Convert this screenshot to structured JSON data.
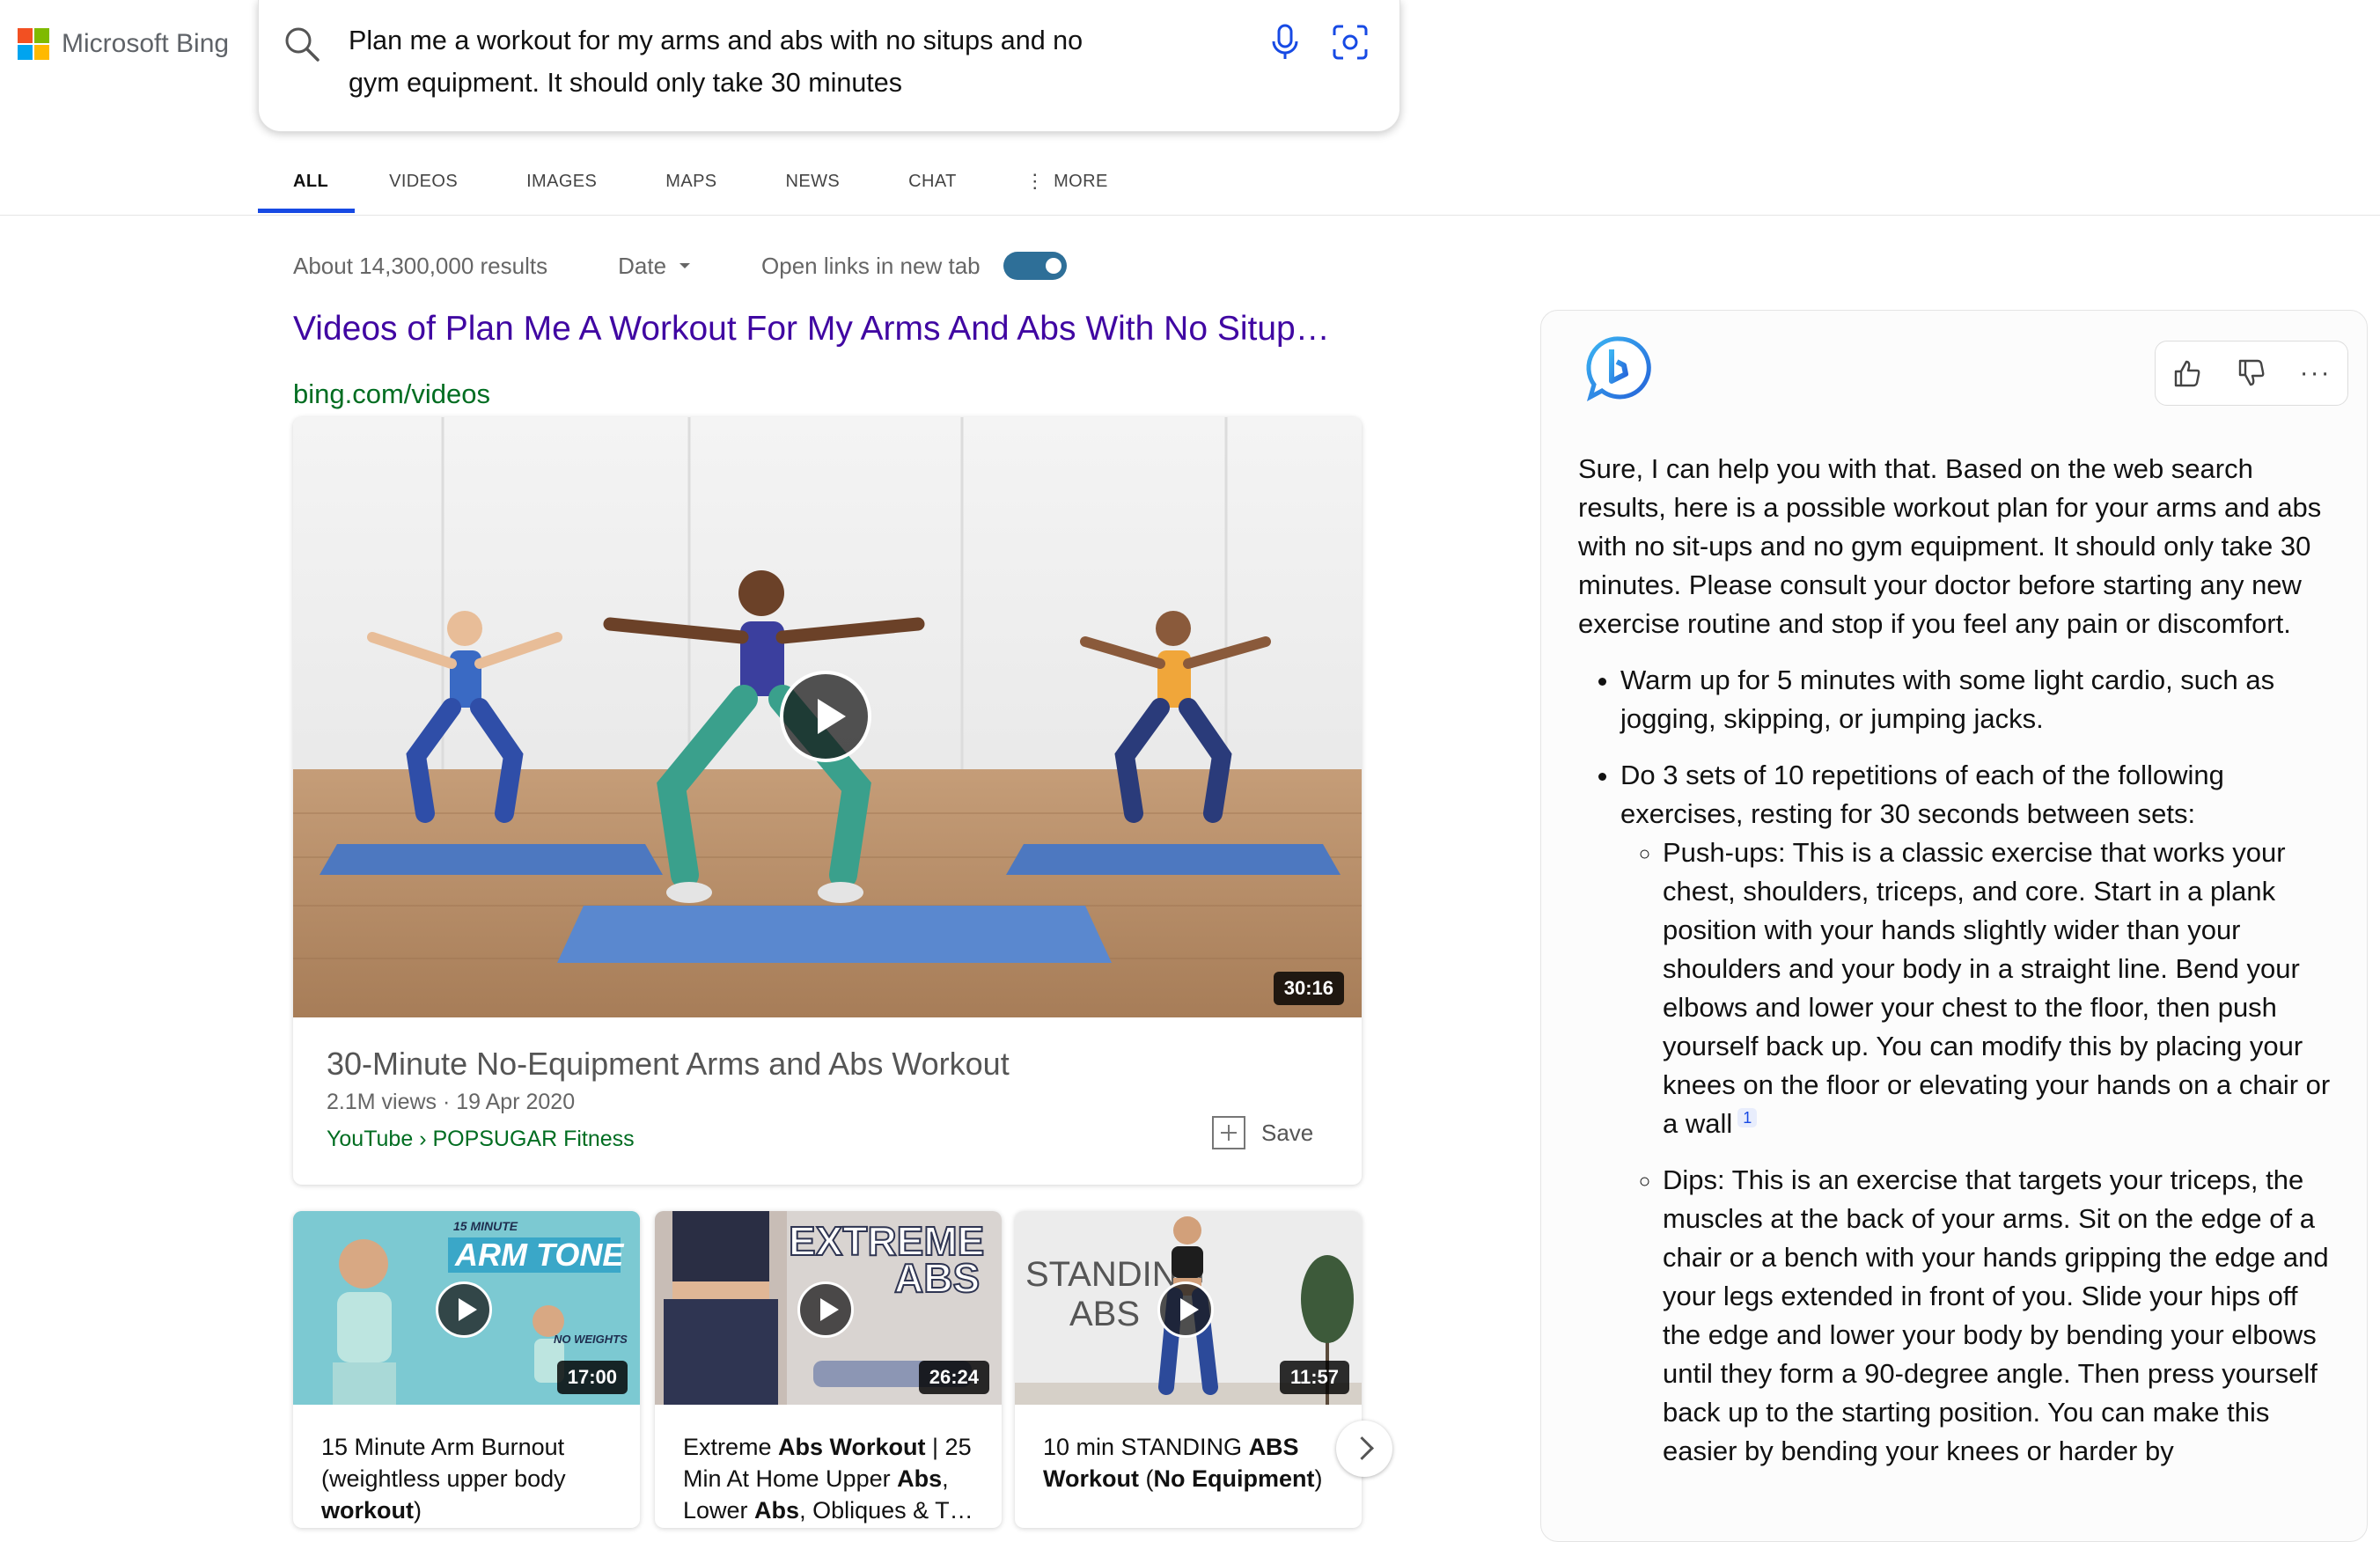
{
  "brand": {
    "logo_text": "Microsoft Bing",
    "logo_colors": [
      "#f25022",
      "#7fba00",
      "#00a4ef",
      "#ffb900"
    ]
  },
  "search": {
    "query_line1": "Plan me a workout for my arms and abs with no situps and no",
    "query_line2": "gym equipment. It should only take 30 minutes"
  },
  "tabs": [
    {
      "label": "ALL",
      "active": true
    },
    {
      "label": "VIDEOS"
    },
    {
      "label": "IMAGES"
    },
    {
      "label": "MAPS"
    },
    {
      "label": "NEWS"
    },
    {
      "label": "CHAT"
    },
    {
      "label": "MORE",
      "icon": "vertical-dots-icon"
    }
  ],
  "results_meta": {
    "count": "About 14,300,000 results",
    "date_filter": "Date",
    "new_tab_label": "Open links in new tab",
    "new_tab_enabled": true
  },
  "result": {
    "title": "Videos of Plan Me A Workout For My Arms And Abs With No Situp…",
    "url": "bing.com/videos"
  },
  "main_video": {
    "duration": "30:16",
    "title": "30-Minute No-Equipment Arms and Abs Workout",
    "stats": "2.1M views · 19 Apr 2020",
    "source": "YouTube › POPSUGAR Fitness",
    "save_label": "Save"
  },
  "small_videos": [
    {
      "duration": "17:00",
      "overlay_top": "15 MINUTE",
      "overlay_main": "ARM TONE",
      "overlay_small": "NO WEIGHTS",
      "title_parts": [
        "15 Minute Arm Burnout (weightless upper body ",
        "workout",
        ")"
      ]
    },
    {
      "duration": "26:24",
      "overlay_main": "EXTREME",
      "overlay_sub": "ABS",
      "title_parts": [
        "Extreme ",
        "Abs Workout",
        " | 25 Min At Home Upper ",
        "Abs",
        ", Lower ",
        "Abs",
        ", Obliques & T…"
      ]
    },
    {
      "duration": "11:57",
      "overlay_main": "STANDING",
      "overlay_sub": "ABS",
      "title_parts": [
        "10 min STANDING ",
        "ABS",
        " ",
        "Workout",
        " (",
        "No Equipment",
        ")"
      ]
    }
  ],
  "chat": {
    "intro": "Sure, I can help you with that. Based on the web search results, here is a possible workout plan for your arms and abs with no sit-ups and no gym equipment. It should only take 30 minutes. Please consult your doctor before starting any new exercise routine and stop if you feel any pain or discomfort.",
    "bullet1": "Warm up for 5 minutes with some light cardio, such as jogging, skipping, or jumping jacks.",
    "bullet2": "Do 3 sets of 10 repetitions of each of the following exercises, resting for 30 seconds between sets:",
    "sub1": "Push-ups: This is a classic exercise that works your chest, shoulders, triceps, and core. Start in a plank position with your hands slightly wider than your shoulders and your body in a straight line. Bend your elbows and lower your chest to the floor, then push yourself back up. You can modify this by placing your knees on the floor or elevating your hands on a chair or a wall",
    "sub1_cite": "1",
    "sub2": "Dips: This is an exercise that targets your triceps, the muscles at the back of your arms. Sit on the edge of a chair or a bench with your hands gripping the edge and your legs extended in front of you. Slide your hips off the edge and lower your body by bending your elbows until they form a 90-degree angle. Then press yourself back up to the starting position. You can make this easier by bending your knees or harder by"
  },
  "colors": {
    "accent_blue": "#174ae4",
    "link_purple": "#4007a2",
    "url_green": "#006d21",
    "toggle": "#2e6f98"
  }
}
